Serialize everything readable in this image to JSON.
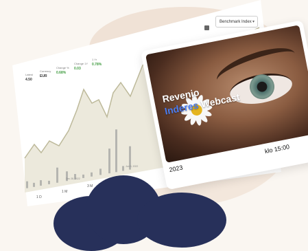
{
  "chart": {
    "stats": [
      {
        "label": "Latest",
        "value": "4.50",
        "color": "#333333"
      },
      {
        "label": "Currency",
        "value": "EUR",
        "color": "#333333"
      },
      {
        "label": "Change %",
        "value": "0.68%",
        "color": "#3d9a3d"
      },
      {
        "label": "Change 1Y",
        "value": "0.03",
        "color": "#3d9a3d"
      },
      {
        "label": "1 Yr",
        "value": "0.78%",
        "color": "#3d9a3d"
      }
    ],
    "benchmark_label": "Benchmark Index",
    "range_buttons": [
      "1 D",
      "1 M",
      "3 M",
      "6 M"
    ],
    "x_ticks": [
      "Dec 28, 2022",
      "Jun 5, 2022"
    ],
    "line_color": "#bdb99a",
    "fill_color": "#ece9dc"
  },
  "video": {
    "title_line1": "Revenio",
    "title_word_blue": "Inderes",
    "title_word_white": "Webcast",
    "date_fragment": "2023",
    "time_fragment": "klo 15:00",
    "accent_color": "#4a7cf0"
  }
}
